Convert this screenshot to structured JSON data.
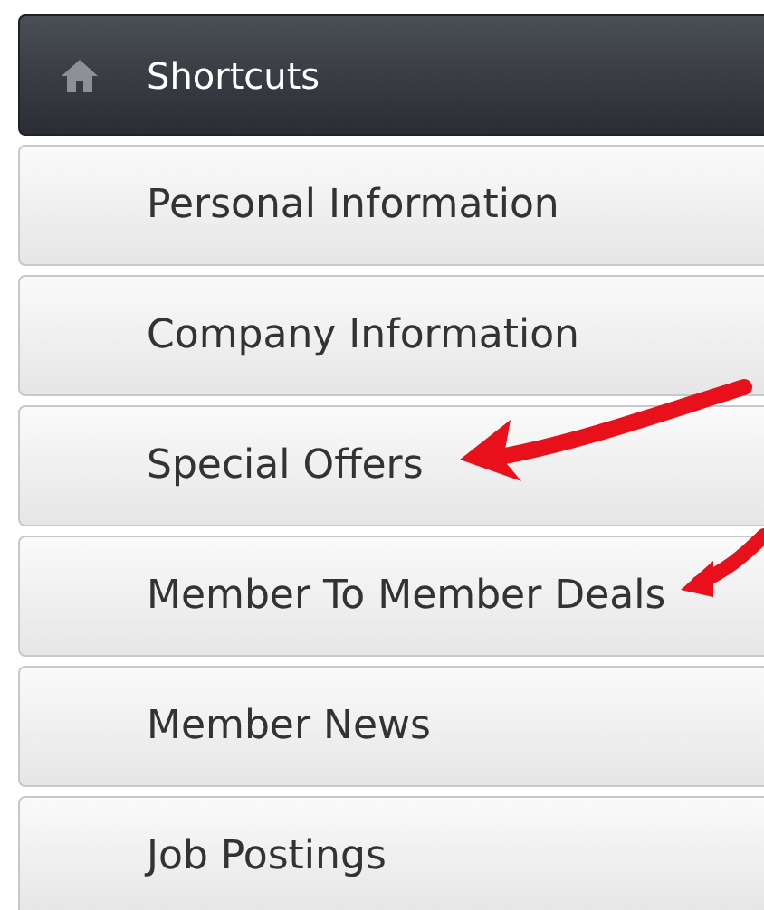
{
  "header": {
    "title": "Shortcuts"
  },
  "items": [
    {
      "label": "Personal Information",
      "annotated": false
    },
    {
      "label": "Company Information",
      "annotated": false
    },
    {
      "label": "Special Offers",
      "annotated": true
    },
    {
      "label": "Member To Member Deals",
      "annotated": true
    },
    {
      "label": "Member News",
      "annotated": false
    },
    {
      "label": "Job Postings",
      "annotated": false
    }
  ]
}
